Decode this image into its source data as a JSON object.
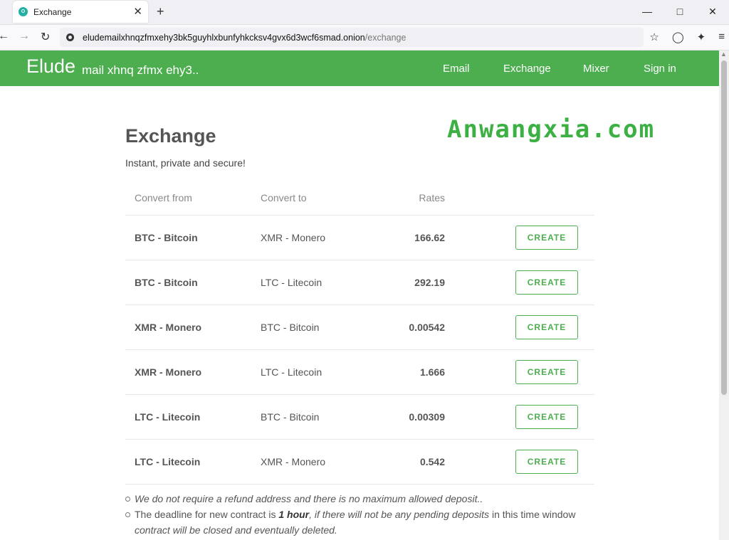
{
  "browser": {
    "tab_title": "Exchange",
    "tab_close": "✕",
    "new_tab": "+",
    "url_host": "eludemailxhnqzfmxehy3bk5guyhlxbunfyhkcksv4gvx6d3wcf6smad.onion",
    "url_path": "/exchange"
  },
  "header": {
    "brand": "Elude",
    "brand_sub": "mail xhnq zfmx ehy3..",
    "nav": [
      "Email",
      "Exchange",
      "Mixer",
      "Sign in"
    ],
    "color": "#4cae4f"
  },
  "page": {
    "title": "Exchange",
    "subtitle": "Instant, private and secure!",
    "watermark": "Anwangxia.com"
  },
  "table": {
    "headers": {
      "from": "Convert from",
      "to": "Convert to",
      "rates": "Rates"
    },
    "button_label": "CREATE",
    "rows": [
      {
        "from": "BTC - Bitcoin",
        "to": "XMR - Monero",
        "rate": "166.62"
      },
      {
        "from": "BTC - Bitcoin",
        "to": "LTC - Litecoin",
        "rate": "292.19"
      },
      {
        "from": "XMR - Monero",
        "to": "BTC - Bitcoin",
        "rate": "0.00542"
      },
      {
        "from": "XMR - Monero",
        "to": "LTC - Litecoin",
        "rate": "1.666"
      },
      {
        "from": "LTC - Litecoin",
        "to": "BTC - Bitcoin",
        "rate": "0.00309"
      },
      {
        "from": "LTC - Litecoin",
        "to": "XMR - Monero",
        "rate": "0.542"
      }
    ]
  },
  "notes": {
    "n1_a": "We do not require a refund address",
    "n1_b": " and there is no maximum allowed deposit..",
    "n2_a": "The deadline for new contract is ",
    "n2_b": "1 hour",
    "n2_c": ", if there will not be any pending deposits",
    "n2_d": " in this time window",
    "n2_e": "contract will be closed and eventually deleted."
  }
}
